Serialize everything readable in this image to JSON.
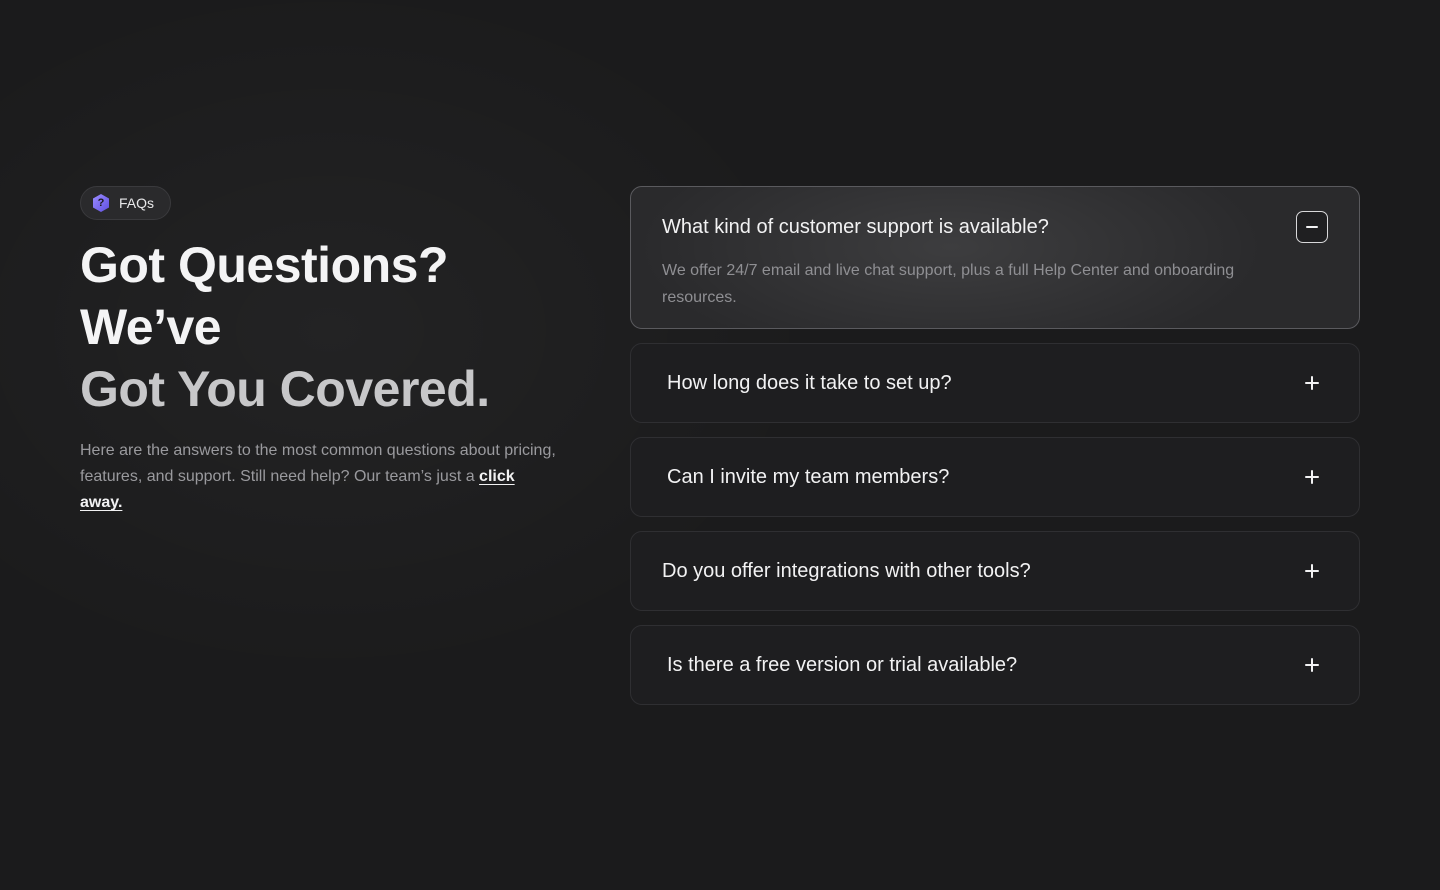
{
  "badge": {
    "label": "FAQs",
    "icon": "question-hexagon-icon",
    "icon_glyph": "?",
    "accent": "#7b6cf6"
  },
  "headline": {
    "line1": "Got Questions? We’ve",
    "line2": "Got You Covered."
  },
  "description": {
    "text": "Here are the answers to the most common questions about pricing, features, and support. Still need help? Our team’s just a ",
    "link_label": "click away."
  },
  "faq": {
    "items": [
      {
        "question": "What kind of customer support is available?",
        "answer": "We offer 24/7 email and live chat support, plus a full Help Center and onboarding resources.",
        "state": "expanded",
        "toggle_icon": "minus-icon"
      },
      {
        "question": "How long does it take to set up?",
        "state": "collapsed",
        "toggle_icon": "plus-icon"
      },
      {
        "question": "Can I invite my team members?",
        "state": "collapsed",
        "toggle_icon": "plus-icon"
      },
      {
        "question": "Do you offer integrations with other tools?",
        "state": "collapsed",
        "toggle_icon": "plus-icon"
      },
      {
        "question": "Is there a free version or trial available?",
        "state": "collapsed",
        "toggle_icon": "plus-icon"
      }
    ]
  }
}
